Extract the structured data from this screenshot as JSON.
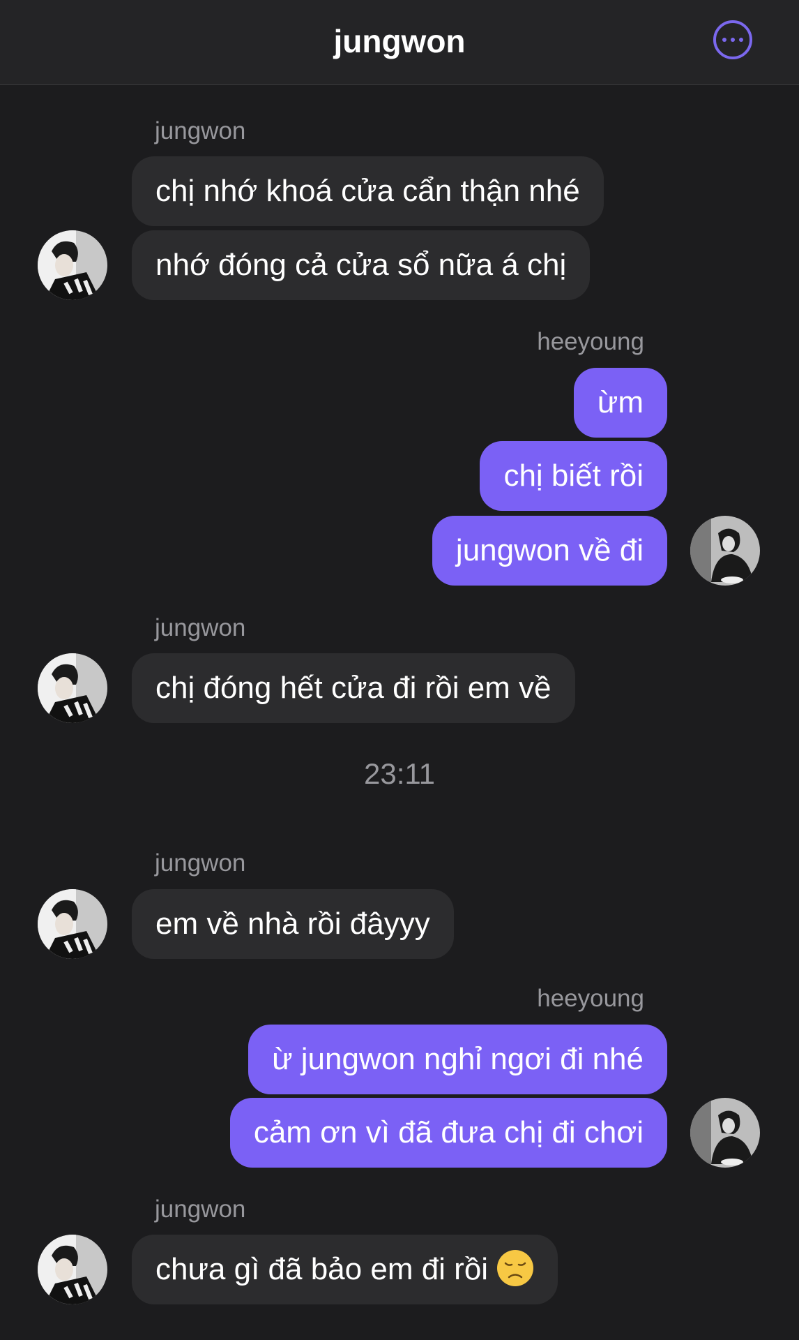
{
  "header": {
    "title": "jungwon",
    "more_icon": "more-horizontal-circle-icon"
  },
  "colors": {
    "background": "#1c1c1e",
    "incoming_bubble": "#2c2c2e",
    "outgoing_bubble": "#7b61f5",
    "accent": "#7b68ee"
  },
  "groups": [
    {
      "sender": "jungwon",
      "messages": [
        "chị nhớ khoá cửa cẩn thận nhé",
        "nhớ đóng cả cửa sổ nữa á chị"
      ]
    },
    {
      "sender": "heeyoung",
      "messages": [
        "ừm",
        "chị biết rồi",
        "jungwon về đi"
      ]
    },
    {
      "sender": "jungwon",
      "messages": [
        "chị đóng hết cửa đi rồi em về"
      ]
    },
    {
      "timestamp": "23:11"
    },
    {
      "sender": "jungwon",
      "messages": [
        "em về nhà rồi đâyyy"
      ]
    },
    {
      "sender": "heeyoung",
      "messages": [
        "ừ jungwon nghỉ ngơi đi nhé",
        "cảm ơn vì đã đưa chị đi chơi"
      ]
    },
    {
      "sender": "jungwon",
      "messages": [
        "chưa gì đã bảo em đi rồi"
      ],
      "emoji": "disappointed-face-icon"
    }
  ]
}
